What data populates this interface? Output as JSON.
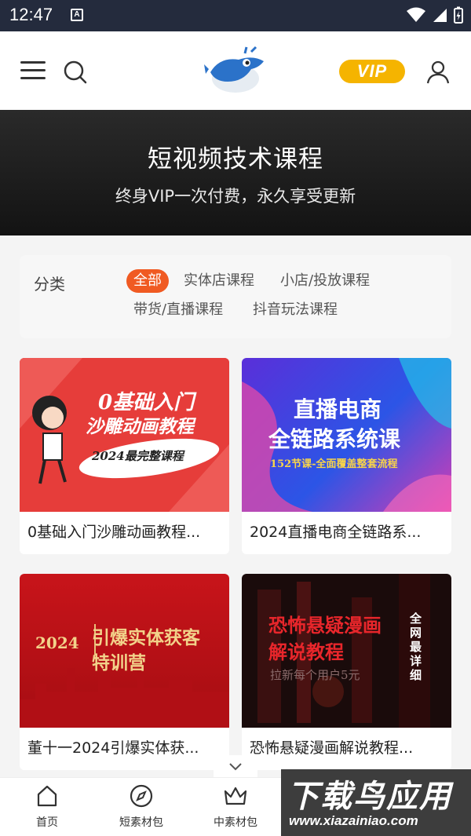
{
  "status_bar": {
    "time": "12:47",
    "notification_icon_label": "A"
  },
  "header": {
    "vip_label": "VIP"
  },
  "banner": {
    "title": "短视频技术课程",
    "subtitle": "终身VIP一次付费，永久享受更新"
  },
  "filter": {
    "label": "分类",
    "options": [
      "全部",
      "实体店课程",
      "小店/投放课程",
      "带货/直播课程",
      "抖音玩法课程"
    ],
    "selected": "全部"
  },
  "courses": [
    {
      "title": "0基础入门沙雕动画教程...",
      "thumb_lines": [
        "0基础入门",
        "沙雕动画教程",
        "2024最完整课程"
      ]
    },
    {
      "title": "2024直播电商全链路系...",
      "thumb_lines": [
        "直播电商",
        "全链路系统课",
        "152节课-全面覆盖整套流程"
      ]
    },
    {
      "title": "董十一2024引爆实体获...",
      "thumb_lines": [
        "2024",
        "引爆实体获客",
        "特训营"
      ]
    },
    {
      "title": "恐怖悬疑漫画解说教程...",
      "thumb_lines": [
        "恐怖悬疑漫画",
        "解说教程",
        "拉新每个用户5元",
        "全网最详细"
      ]
    }
  ],
  "bottom_nav": [
    {
      "label": "首页",
      "icon": "home-icon"
    },
    {
      "label": "短素材包",
      "icon": "compass-icon"
    },
    {
      "label": "中素材包",
      "icon": "crown-icon"
    }
  ],
  "watermark": {
    "line1": "下载鸟应用",
    "line2": "www.xiazainiao.com"
  },
  "colors": {
    "accent": "#f05a22",
    "vip": "#f5b400",
    "status_bar": "#242b3d"
  }
}
